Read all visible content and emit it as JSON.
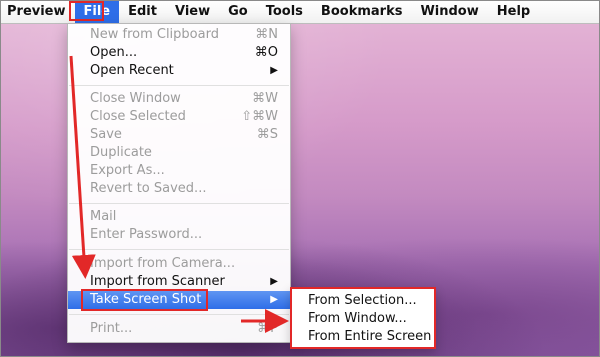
{
  "menubar": {
    "items": [
      "Preview",
      "File",
      "Edit",
      "View",
      "Go",
      "Tools",
      "Bookmarks",
      "Window",
      "Help"
    ]
  },
  "file_menu": {
    "new_from_clipboard": {
      "label": "New from Clipboard",
      "shortcut": "⌘N"
    },
    "open": {
      "label": "Open...",
      "shortcut": "⌘O"
    },
    "open_recent": {
      "label": "Open Recent"
    },
    "close_window": {
      "label": "Close Window",
      "shortcut": "⌘W"
    },
    "close_selected": {
      "label": "Close Selected",
      "shortcut": "⇧⌘W"
    },
    "save": {
      "label": "Save",
      "shortcut": "⌘S"
    },
    "duplicate": {
      "label": "Duplicate"
    },
    "export_as": {
      "label": "Export As..."
    },
    "revert": {
      "label": "Revert to Saved..."
    },
    "mail": {
      "label": "Mail"
    },
    "enter_password": {
      "label": "Enter Password..."
    },
    "import_camera": {
      "label": "Import from Camera..."
    },
    "import_scanner": {
      "label": "Import from Scanner"
    },
    "take_screenshot": {
      "label": "Take Screen Shot"
    },
    "print": {
      "label": "Print...",
      "shortcut": "⌘P"
    }
  },
  "submenu": {
    "items": [
      "From Selection...",
      "From Window...",
      "From Entire Screen"
    ]
  },
  "colors": {
    "highlight": "#2f6ee8",
    "annotation": "#e22828"
  }
}
